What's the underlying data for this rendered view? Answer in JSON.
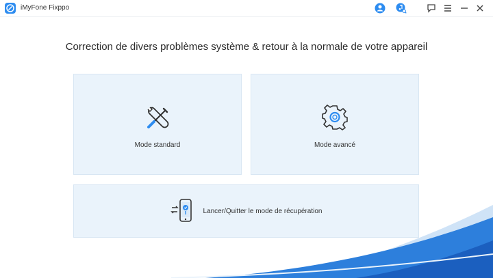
{
  "window": {
    "title": "iMyFone Fixppo"
  },
  "titlebar": {
    "icons": [
      "account-icon",
      "music-search-icon",
      "feedback-icon",
      "menu-icon",
      "minimize-icon",
      "close-icon"
    ]
  },
  "main": {
    "headline": "Correction de divers problèmes système & retour à la normale de votre appareil",
    "cards": {
      "standard": {
        "label": "Mode standard",
        "icon": "wrench-screwdriver-icon"
      },
      "advanced": {
        "label": "Mode avancé",
        "icon": "gear-icon"
      },
      "recovery": {
        "label": "Lancer/Quitter le mode de récupération",
        "icon": "phone-recovery-icon"
      }
    }
  },
  "colors": {
    "accent": "#2d8cf0",
    "card_bg": "#eaf3fb",
    "wave_dark": "#1f6fd1",
    "wave_light": "#cfe3f7"
  }
}
